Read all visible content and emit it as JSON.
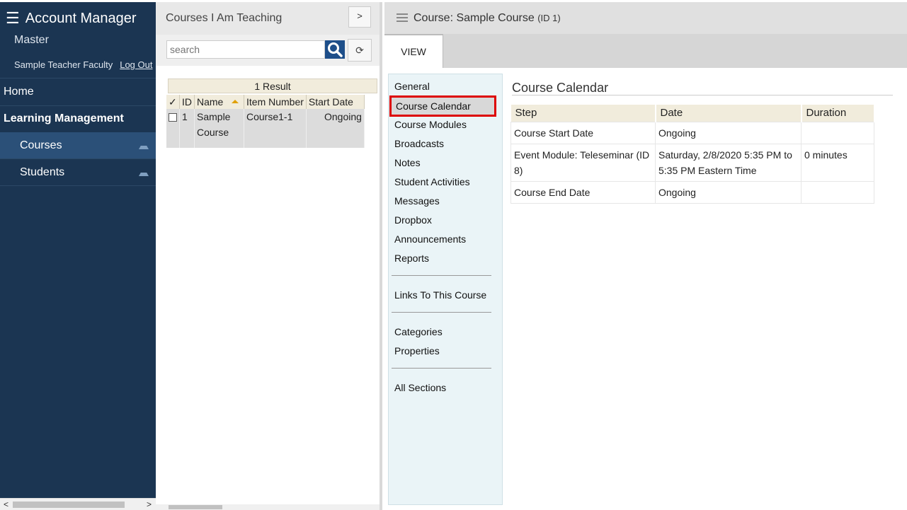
{
  "nav": {
    "app_title": "Account Manager",
    "account": "Master",
    "user": "Sample Teacher Faculty",
    "logout": "Log Out",
    "home": "Home",
    "section": "Learning Management",
    "items": [
      {
        "label": "Courses"
      },
      {
        "label": "Students"
      }
    ]
  },
  "list_panel": {
    "title": "Courses I Am Teaching",
    "expand_label": ">",
    "search_placeholder": "search",
    "refresh_icon": "refresh-icon",
    "result_count": "1 Result",
    "columns": [
      "✓",
      "ID",
      "Name",
      "Item Number",
      "Start Date"
    ],
    "rows": [
      {
        "id": "1",
        "name_line1": "Sample",
        "name_line2": "Course",
        "item_number": "Course1-1",
        "start_date": "Ongoing"
      }
    ]
  },
  "detail": {
    "title": "Course: Sample Course",
    "title_id": "(ID 1)",
    "tab": "VIEW",
    "menu": [
      "General",
      "Course Calendar",
      "Course Modules",
      "Broadcasts",
      "Notes",
      "Student Activities",
      "Messages",
      "Dropbox",
      "Announcements",
      "Reports"
    ],
    "menu2": [
      "Links To This Course"
    ],
    "menu3": [
      "Categories",
      "Properties"
    ],
    "menu4": [
      "All Sections"
    ],
    "active_item": "Course Calendar",
    "calendar": {
      "heading": "Course Calendar",
      "columns": [
        "Step",
        "Date",
        "Duration"
      ],
      "rows": [
        {
          "step": "Course Start Date",
          "date": "Ongoing",
          "duration": ""
        },
        {
          "step": "Event Module: Teleseminar (ID 8)",
          "date": "Saturday, 2/8/2020 5:35 PM to 5:35 PM Eastern Time",
          "duration": "0 minutes"
        },
        {
          "step": "Course End Date",
          "date": "Ongoing",
          "duration": ""
        }
      ]
    }
  },
  "colors": {
    "nav_bg": "#1b3552",
    "nav_active": "#2b5078",
    "highlight_border": "#dd0000",
    "table_header": "#f1ecdc",
    "side_menu_bg": "#eaf4f7"
  }
}
